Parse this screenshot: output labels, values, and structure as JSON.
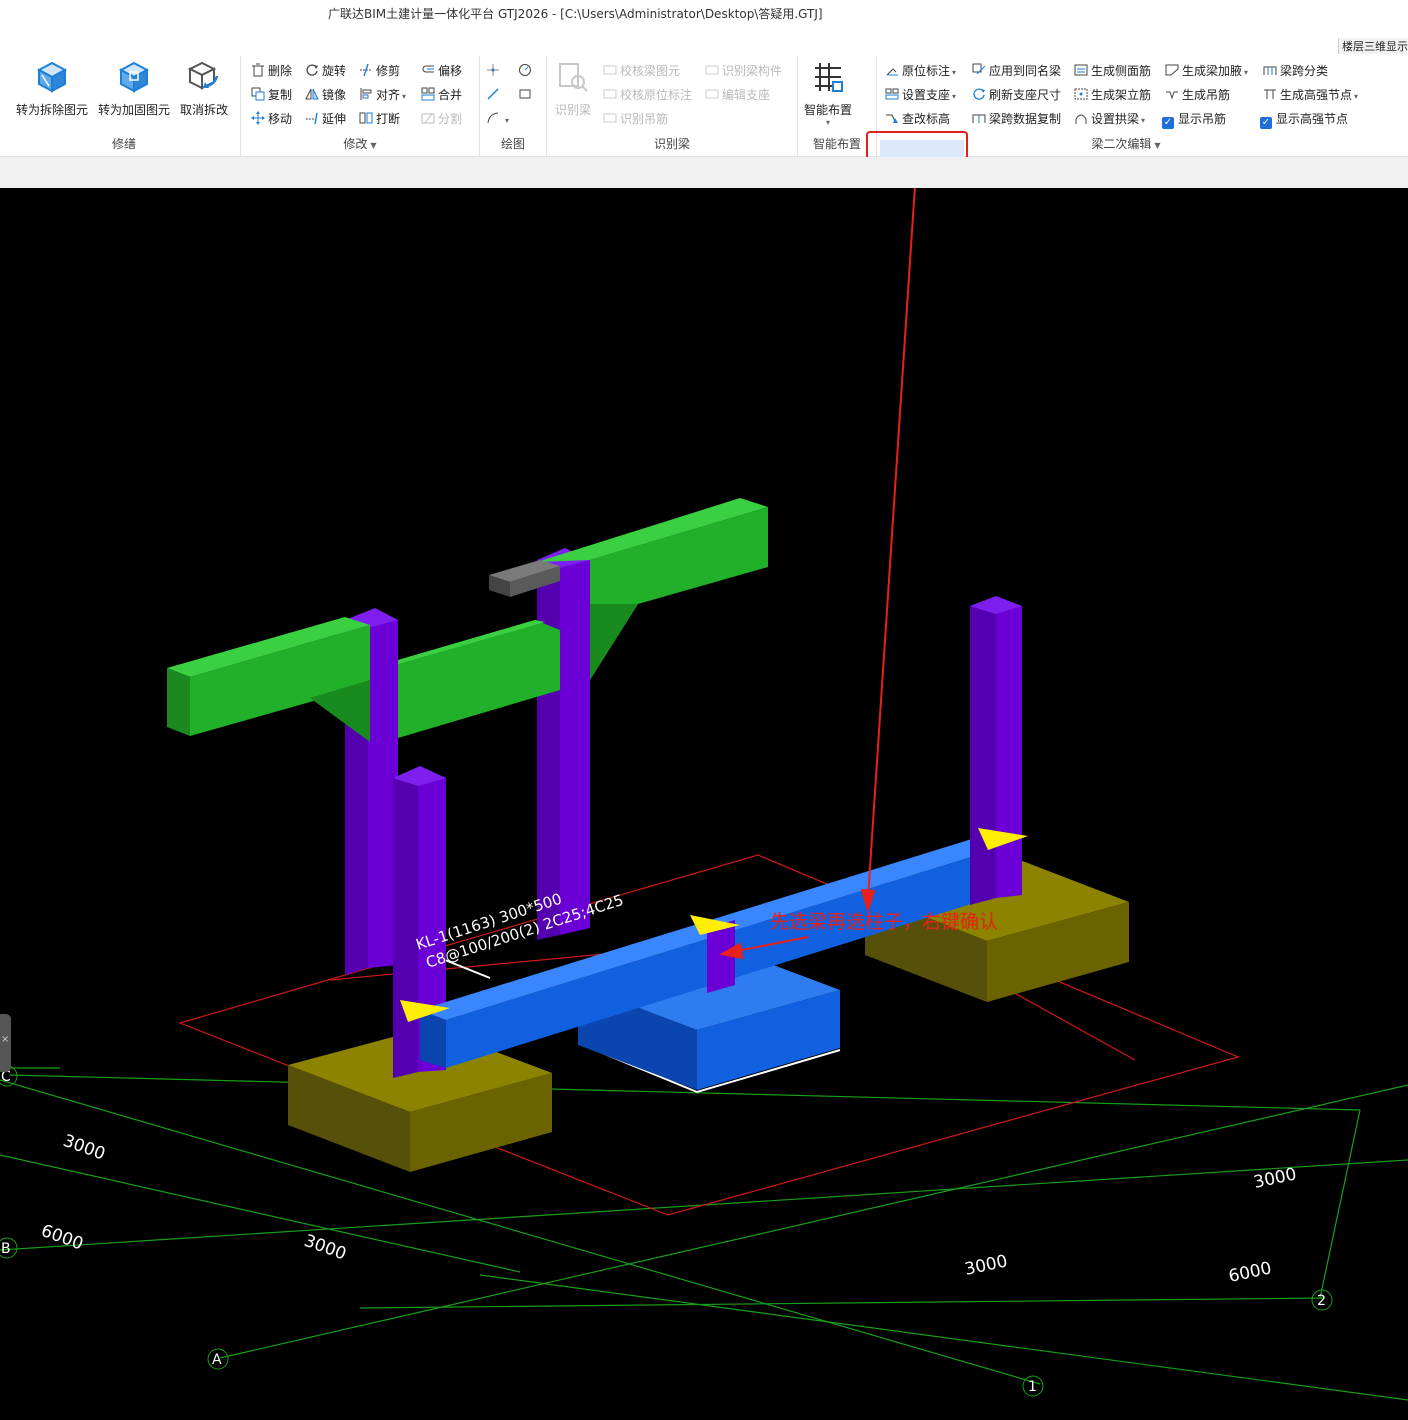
{
  "window": {
    "title": "广联达BIM土建计量一体化平台 GTJ2026 - [C:\\Users\\Administrator\\Desktop\\答疑用.GTJ]",
    "top_right_tab": "楼层三维显示"
  },
  "ribbon": {
    "groups": {
      "xiubian": {
        "label": "修缮",
        "buttons": [
          "转为拆除图元",
          "转为加固图元",
          "取消拆改"
        ]
      },
      "xiugai": {
        "label": "修改",
        "buttons": [
          "删除",
          "旋转",
          "修剪",
          "偏移",
          "复制",
          "镜像",
          "对齐",
          "合并",
          "移动",
          "延伸",
          "打断",
          "分割"
        ]
      },
      "huitu": {
        "label": "绘图"
      },
      "shibieliang": {
        "label": "识别梁",
        "big": "识别梁",
        "buttons": [
          "校核梁图元",
          "识别梁构件",
          "校核原位标注",
          "编辑支座",
          "识别吊筋"
        ]
      },
      "zhineng": {
        "label": "智能布置",
        "big": "智能布置"
      },
      "liang2": {
        "label": "梁二次编辑",
        "buttons": [
          "原位标注",
          "应用到同名梁",
          "生成侧面筋",
          "生成梁加腋",
          "梁跨分类",
          "设置支座",
          "刷新支座尺寸",
          "生成架立筋",
          "生成吊筋",
          "生成高强节点",
          "查改标高",
          "梁跨数据复制",
          "设置拱梁",
          "显示吊筋",
          "显示高强节点"
        ]
      }
    }
  },
  "viewport": {
    "beam_label_line1": "KL-1(1163) 300*500",
    "beam_label_line2": "C8@100/200(2) 2C25;4C25",
    "annotation": "先选梁再选柱子，右键确认",
    "axes": [
      "C",
      "B",
      "A",
      "1",
      "2"
    ],
    "dims": [
      "3000",
      "6000",
      "3000",
      "3000",
      "3000",
      "6000"
    ],
    "colors": {
      "background": "#000000",
      "beam_green": "#22b02a",
      "column_purple": "#6a00d6",
      "beam_blue": "#1060e0",
      "footing_olive": "#6b6300",
      "grid_green": "#1a9e1a",
      "grid_red": "#d01818",
      "marker_yellow": "#ffee00",
      "annotation_red": "#e8201a"
    }
  }
}
